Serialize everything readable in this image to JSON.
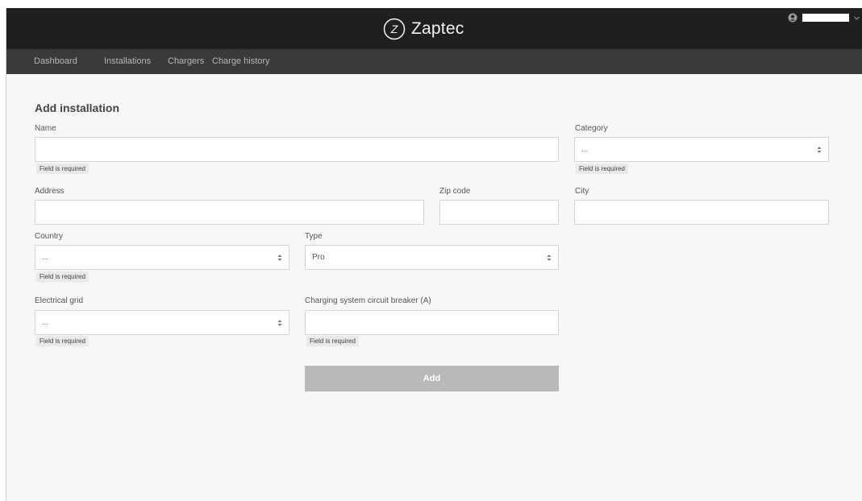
{
  "header": {
    "brand_name": "Zaptec",
    "brand_mark": "Z"
  },
  "nav": {
    "items": [
      {
        "label": "Dashboard"
      },
      {
        "label": "Installations"
      },
      {
        "label": "Chargers"
      },
      {
        "label": "Charge history"
      }
    ]
  },
  "user_menu": {
    "icon": "user-circle-icon",
    "caret": "chevron-down-icon"
  },
  "form": {
    "title": "Add installation",
    "required_message": "Field is required",
    "name": {
      "label": "Name",
      "value": ""
    },
    "category": {
      "label": "Category",
      "value": "..."
    },
    "address": {
      "label": "Address",
      "value": ""
    },
    "zip": {
      "label": "Zip code",
      "value": ""
    },
    "city": {
      "label": "City",
      "value": ""
    },
    "country": {
      "label": "Country",
      "value": "..."
    },
    "type": {
      "label": "Type",
      "value": "Pro"
    },
    "electrical_grid": {
      "label": "Electrical grid",
      "value": "..."
    },
    "breaker": {
      "label": "Charging system circuit breaker (A)",
      "value": ""
    },
    "submit_label": "Add"
  },
  "colors": {
    "topbar": "#1f1f1f",
    "navbar": "#3a3a3a",
    "page_bg": "#f7f7f7",
    "button_disabled": "#b9b9b9"
  }
}
